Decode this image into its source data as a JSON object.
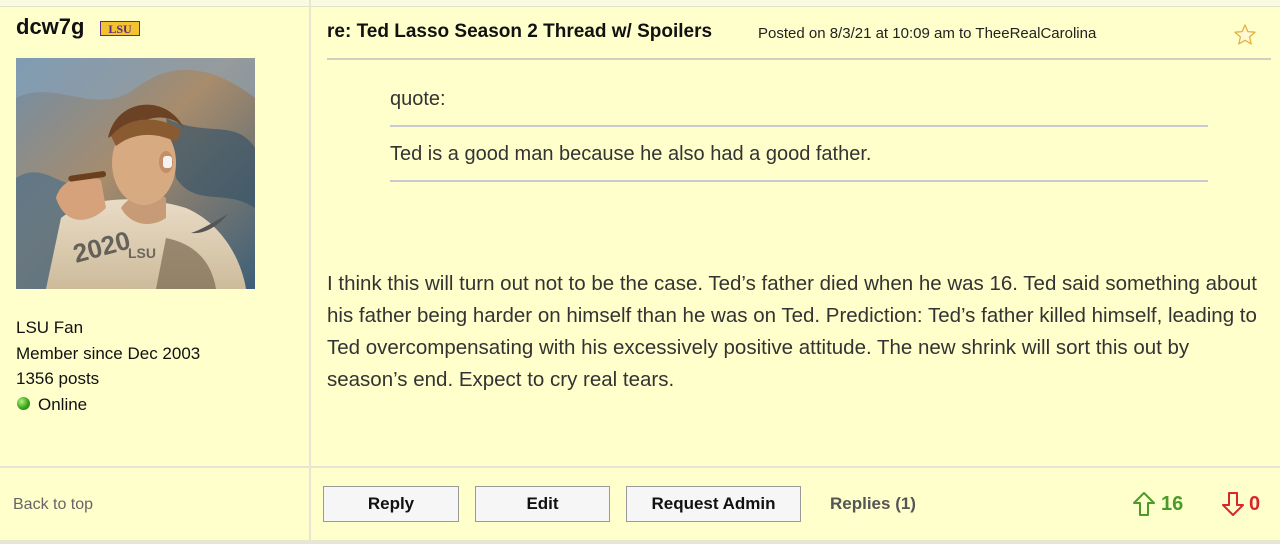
{
  "user": {
    "username": "dcw7g",
    "team_badge": "LSU",
    "fan_of": "LSU Fan",
    "member_since": "Member since Dec 2003",
    "posts": "1356 posts",
    "status": "Online"
  },
  "post": {
    "title": "re: Ted Lasso Season 2 Thread w/ Spoilers",
    "posted_prefix": "Posted on 8/3/21 at 10:09 am to",
    "posted_to": "TheeRealCarolina",
    "quote_label": "quote:",
    "quote_text": "Ted is a good man because he also had a good father.",
    "body": "I think this will turn out not to be the case. Ted’s father died when he was 16. Ted said something about his father being harder on himself than he was on Ted. Prediction: Ted’s father killed himself, leading to Ted overcompensating with his excessively positive attitude. The new shrink will sort this out by season’s end. Expect to cry real tears."
  },
  "footer": {
    "back_to_top": "Back to top",
    "reply": "Reply",
    "edit": "Edit",
    "request_admin": "Request Admin",
    "replies": "Replies (1)",
    "upvotes": "16",
    "downvotes": "0"
  },
  "colors": {
    "background": "#ffffcc",
    "upvote": "#4c9a2a",
    "downvote": "#d9262c",
    "badge_purple": "#5b2a86",
    "badge_gold": "#f2c230"
  },
  "icons": {
    "favorite": "star-icon",
    "upvote": "arrow-up-icon",
    "downvote": "arrow-down-icon",
    "status": "online-dot-icon"
  }
}
